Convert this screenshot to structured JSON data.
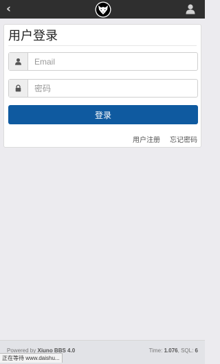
{
  "topbar": {
    "back_icon": "chevron-left-icon",
    "logo_icon": "wolf-logo-icon",
    "user_icon": "user-icon"
  },
  "login": {
    "title": "用户登录",
    "email_placeholder": "Email",
    "password_placeholder": "密码",
    "submit_label": "登录",
    "register_link": "用户注册",
    "forgot_link": "忘记密码"
  },
  "footer": {
    "powered_prefix": "Powered by",
    "powered_name": "Xiuno BBS 4.0",
    "time_label": "Time:",
    "time_value": "1.076",
    "sql_label": "SQL:",
    "sql_value": "6"
  },
  "statusbar": {
    "text": "正在等待 www.daishu..."
  },
  "colors": {
    "topbar": "#2f2f2f",
    "primary": "#0f5aa0",
    "background": "#ecebef"
  }
}
